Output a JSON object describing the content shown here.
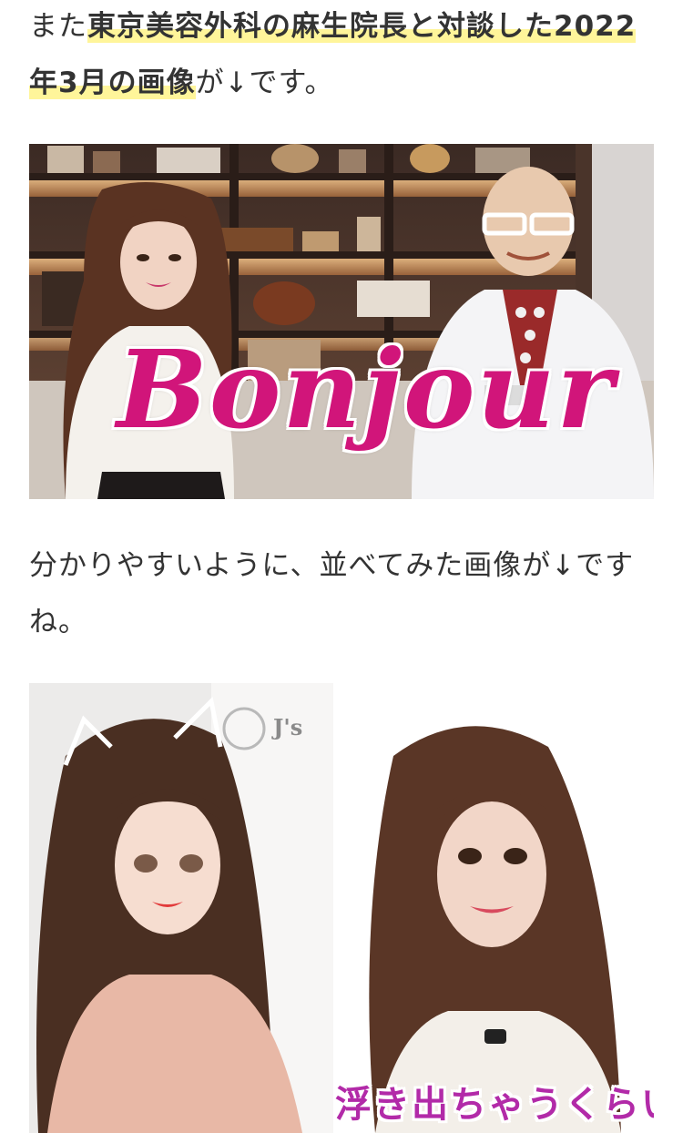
{
  "article": {
    "para1": {
      "prefix": "また",
      "highlight": "東京美容外科の麻生院長と対談した2022年3月の画像",
      "suffix": "が↓です。"
    },
    "para2": {
      "text": "分かりやすいように、並べてみた画像が↓ですね。"
    }
  },
  "photo1": {
    "overlay": "Bonjour"
  },
  "photo2": {
    "sign": "J's",
    "caption": "浮き出ちゃうくらい"
  },
  "colors": {
    "highlight": "#fff59a",
    "text": "#333333",
    "overlay_pink": "#d1157a",
    "caption_purple": "#b22aa8"
  }
}
